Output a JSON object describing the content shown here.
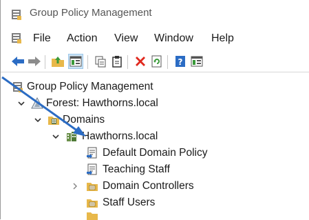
{
  "window": {
    "title": "Group Policy Management"
  },
  "menu": {
    "file": "File",
    "action": "Action",
    "view": "View",
    "window": "Window",
    "help": "Help"
  },
  "toolbar": {
    "icons": [
      "back-icon",
      "forward-icon",
      "up-folder-icon",
      "show-hide-tree-icon",
      "copy-icon",
      "paste-icon",
      "delete-icon",
      "refresh-icon",
      "help-icon",
      "properties-icon"
    ]
  },
  "tree": {
    "root": "Group Policy Management",
    "forest": "Forest: Hawthorns.local",
    "domains": "Domains",
    "domain": "Hawthorns.local",
    "items": [
      "Default Domain Policy",
      "Teaching Staff",
      "Domain Controllers",
      "Staff Users"
    ]
  },
  "colors": {
    "accent_blue": "#2b6cc4",
    "delete_red": "#e0281d",
    "folder_yellow": "#e8b84a"
  }
}
